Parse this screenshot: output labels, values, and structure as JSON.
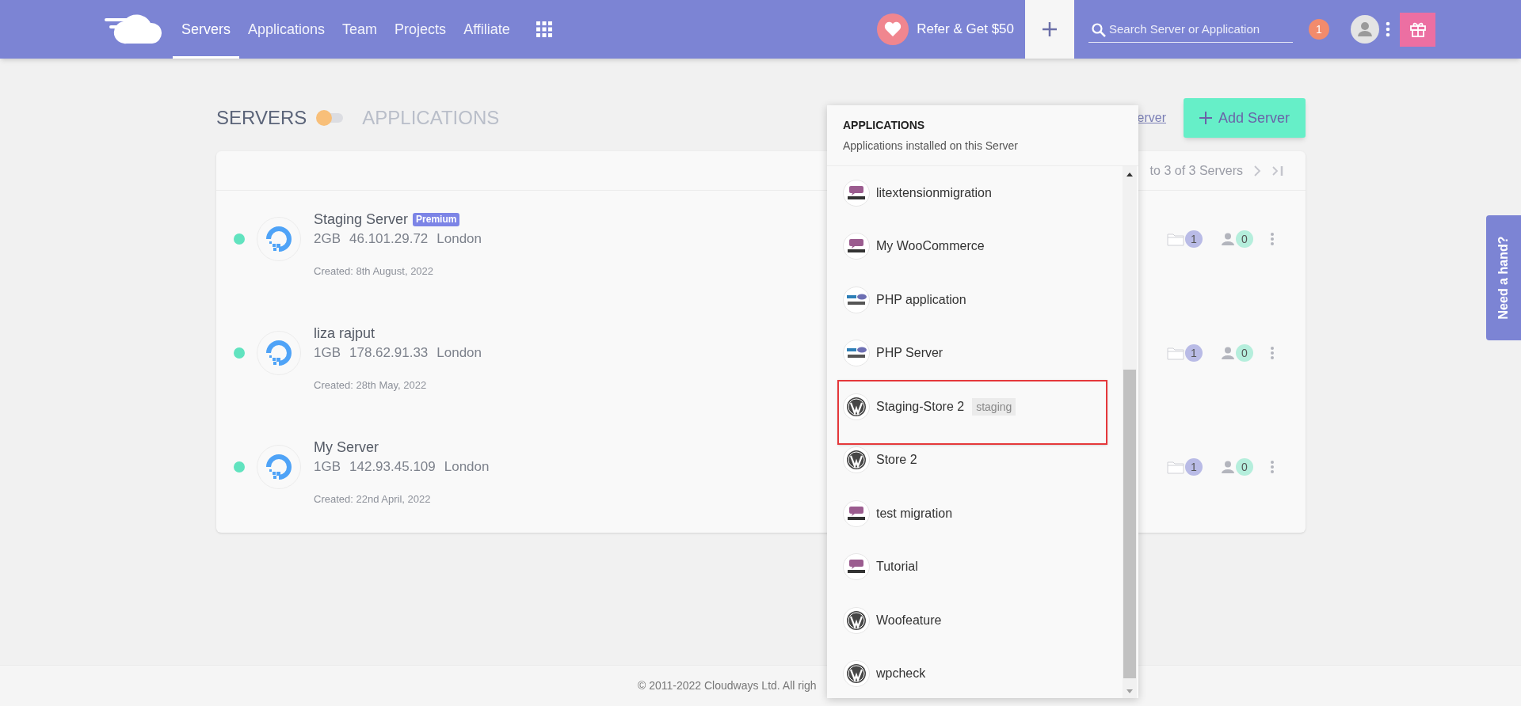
{
  "top_bar": {
    "nav": [
      {
        "label": "Servers",
        "selected": true
      },
      {
        "label": "Applications",
        "selected": false
      },
      {
        "label": "Team",
        "selected": false
      },
      {
        "label": "Projects",
        "selected": false
      },
      {
        "label": "Affiliate",
        "selected": false
      }
    ],
    "refer": "Refer & Get $50",
    "search": {
      "placeholder": "Search Server or Application"
    },
    "notifications": "1"
  },
  "view_toggle": [
    {
      "label": "SERVERS",
      "selected": true
    },
    {
      "label": "APPLICATIONS",
      "selected": false
    }
  ],
  "link": "erver",
  "add_button": "Add Server",
  "pagination": "to 3 of 3 Servers",
  "servers": [
    {
      "name": "Staging Server",
      "badge": "Premium",
      "size": "2GB",
      "ip": "46.101.29.72",
      "location": "London",
      "created": "Created: 8th August, 2022",
      "online": true,
      "apps": "1",
      "members": "0"
    },
    {
      "name": "liza rajput",
      "size": "1GB",
      "ip": "178.62.91.33",
      "location": "London",
      "created": "Created: 28th May, 2022",
      "online": true,
      "apps": "1",
      "members": "0"
    },
    {
      "name": "My Server",
      "size": "1GB",
      "ip": "142.93.45.109",
      "location": "London",
      "created": "Created: 22nd April, 2022",
      "online": true,
      "apps": "1",
      "members": "0"
    }
  ],
  "popup": {
    "title": "APPLICATIONS",
    "subtitle": "Applications installed on this Server",
    "apps": [
      {
        "name": "litextensionmigration",
        "kind": "woocommerce",
        "highlighted": false
      },
      {
        "name": "My WooCommerce",
        "kind": "woocommerce",
        "highlighted": false
      },
      {
        "name": "PHP application",
        "kind": "php",
        "highlighted": false
      },
      {
        "name": "PHP Server",
        "kind": "php",
        "highlighted": false
      },
      {
        "name": "Staging-Store 2",
        "tag": "staging",
        "kind": "wordpress",
        "highlighted": true
      },
      {
        "name": "Store 2",
        "kind": "wordpress",
        "highlighted": false
      },
      {
        "name": "test migration",
        "kind": "woocommerce",
        "highlighted": false
      },
      {
        "name": "Tutorial",
        "kind": "woocommerce",
        "highlighted": false
      },
      {
        "name": "Woofeature",
        "kind": "wordpress",
        "highlighted": false
      },
      {
        "name": "wpcheck",
        "kind": "wordpress",
        "highlighted": false
      }
    ]
  },
  "help_tab": "Need a hand?",
  "footer": "© 2011-2022 Cloudways Ltd. All righ"
}
